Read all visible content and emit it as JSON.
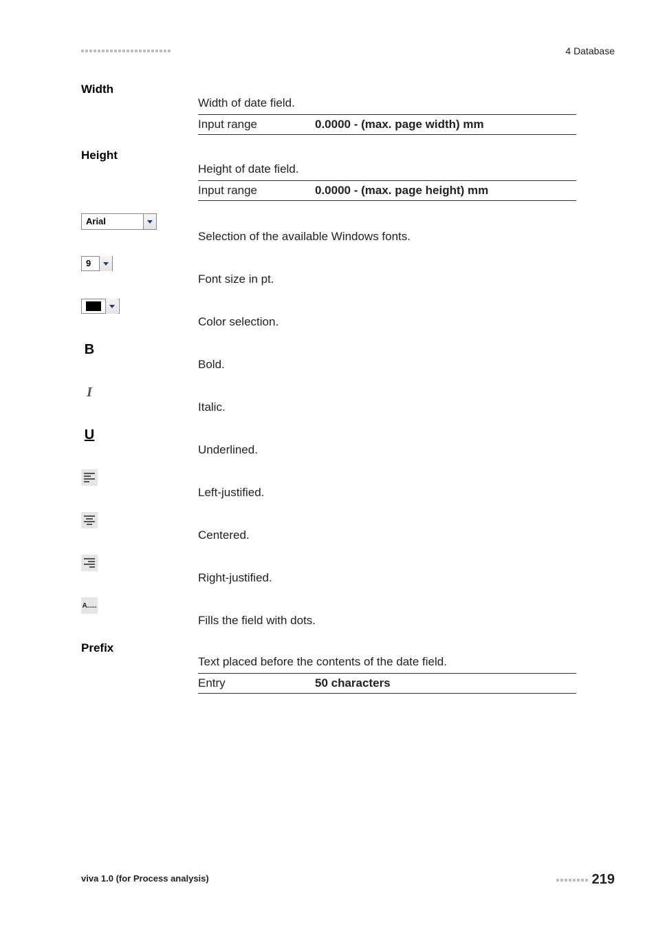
{
  "header": {
    "section": "4 Database"
  },
  "items": [
    {
      "type": "label_param",
      "label": "Width",
      "desc": "Width of date field.",
      "param_left": "Input range",
      "param_right": "0.0000 - (max. page width) mm"
    },
    {
      "type": "label_param",
      "label": "Height",
      "desc": "Height of date field.",
      "param_left": "Input range",
      "param_right": "0.0000 - (max. page height) mm"
    },
    {
      "type": "icon_font_dropdown",
      "value": "Arial",
      "desc": "Selection of the available Windows fonts."
    },
    {
      "type": "icon_size_dropdown",
      "value": "9",
      "desc": "Font size in pt."
    },
    {
      "type": "icon_color_dropdown",
      "desc": "Color selection."
    },
    {
      "type": "icon_bold",
      "desc": "Bold."
    },
    {
      "type": "icon_italic",
      "desc": "Italic."
    },
    {
      "type": "icon_underline",
      "desc": "Underlined."
    },
    {
      "type": "icon_align_left",
      "desc": "Left-justified."
    },
    {
      "type": "icon_align_center",
      "desc": "Centered."
    },
    {
      "type": "icon_align_right",
      "desc": "Right-justified."
    },
    {
      "type": "icon_dots",
      "glyph": "A.....",
      "desc": "Fills the field with dots."
    },
    {
      "type": "label_param",
      "label": "Prefix",
      "desc": "Text placed before the contents of the date field.",
      "param_left": "Entry",
      "param_right": "50 characters"
    }
  ],
  "footer": {
    "product": "viva 1.0 (for Process analysis)",
    "page": "219"
  }
}
